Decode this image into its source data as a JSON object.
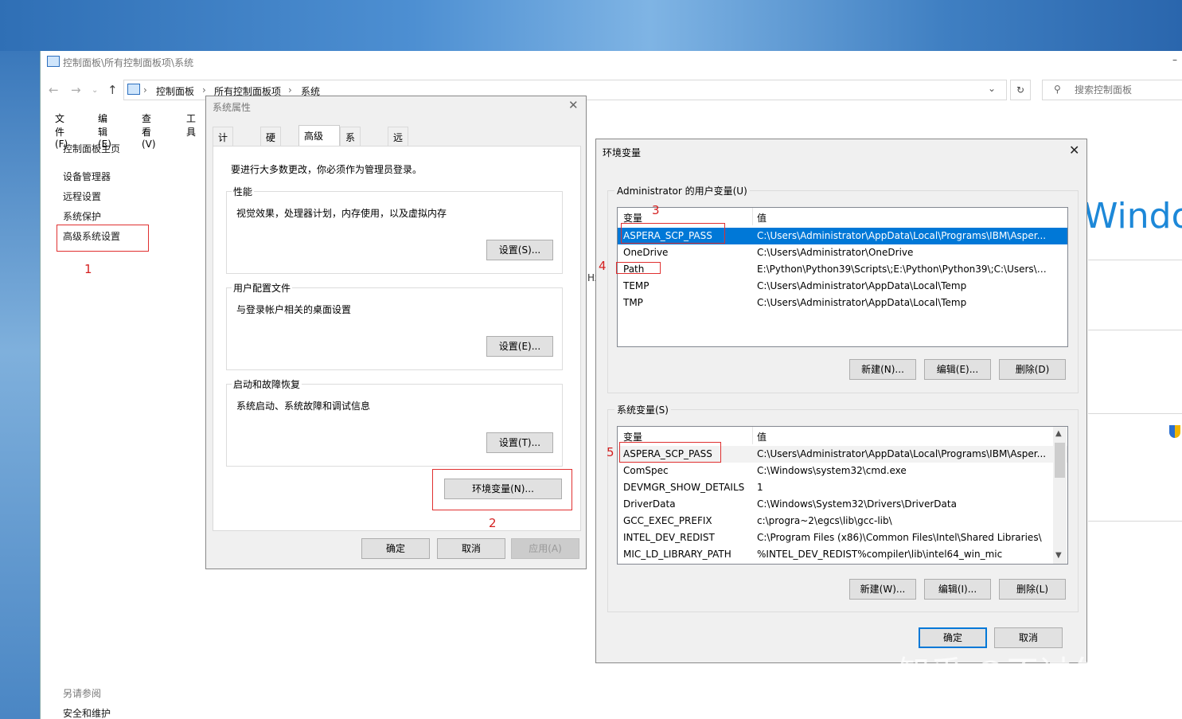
{
  "control_panel": {
    "title": "控制面板\\所有控制面板项\\系统",
    "breadcrumbs": [
      "控制面板",
      "所有控制面板项",
      "系统"
    ],
    "search_placeholder": "搜索控制面板",
    "menu": [
      "文件(F)",
      "编辑(E)",
      "查看(V)",
      "工具"
    ],
    "sidebar": {
      "home": "控制面板主页",
      "links": [
        "设备管理器",
        "远程设置",
        "系统保护",
        "高级系统设置"
      ],
      "see_also_title": "另请参阅",
      "see_also": [
        "安全和维护"
      ]
    },
    "windows_logo_text": "Windov",
    "hz_text": "Hz"
  },
  "annotations": {
    "n1": "1",
    "n2": "2",
    "n3": "3",
    "n4": "4",
    "n5": "5"
  },
  "system_properties": {
    "title": "系统属性",
    "tabs": [
      "计算机名",
      "硬件",
      "高级",
      "系统保护",
      "远程"
    ],
    "active_tab": "高级",
    "admin_note": "要进行大多数更改，你必须作为管理员登录。",
    "groups": [
      {
        "title": "性能",
        "desc": "视觉效果，处理器计划，内存使用，以及虚拟内存",
        "button": "设置(S)..."
      },
      {
        "title": "用户配置文件",
        "desc": "与登录帐户相关的桌面设置",
        "button": "设置(E)..."
      },
      {
        "title": "启动和故障恢复",
        "desc": "系统启动、系统故障和调试信息",
        "button": "设置(T)..."
      }
    ],
    "env_button": "环境变量(N)...",
    "ok": "确定",
    "cancel": "取消",
    "apply": "应用(A)"
  },
  "env_vars": {
    "title": "环境变量",
    "user_group_title": "Administrator 的用户变量(U)",
    "system_group_title": "系统变量(S)",
    "col_var": "变量",
    "col_val": "值",
    "user_vars": [
      {
        "var": "ASPERA_SCP_PASS",
        "val": "C:\\Users\\Administrator\\AppData\\Local\\Programs\\IBM\\Asper..."
      },
      {
        "var": "OneDrive",
        "val": "C:\\Users\\Administrator\\OneDrive"
      },
      {
        "var": "Path",
        "val": "E:\\Python\\Python39\\Scripts\\;E:\\Python\\Python39\\;C:\\Users\\Ad..."
      },
      {
        "var": "TEMP",
        "val": "C:\\Users\\Administrator\\AppData\\Local\\Temp"
      },
      {
        "var": "TMP",
        "val": "C:\\Users\\Administrator\\AppData\\Local\\Temp"
      }
    ],
    "system_vars": [
      {
        "var": "ASPERA_SCP_PASS",
        "val": "C:\\Users\\Administrator\\AppData\\Local\\Programs\\IBM\\Asper..."
      },
      {
        "var": "ComSpec",
        "val": "C:\\Windows\\system32\\cmd.exe"
      },
      {
        "var": "DEVMGR_SHOW_DETAILS",
        "val": "1"
      },
      {
        "var": "DriverData",
        "val": "C:\\Windows\\System32\\Drivers\\DriverData"
      },
      {
        "var": "GCC_EXEC_PREFIX",
        "val": "c:\\progra~2\\egcs\\lib\\gcc-lib\\"
      },
      {
        "var": "INTEL_DEV_REDIST",
        "val": "C:\\Program Files (x86)\\Common Files\\Intel\\Shared Libraries\\"
      },
      {
        "var": "MIC_LD_LIBRARY_PATH",
        "val": "%INTEL_DEV_REDIST%compiler\\lib\\intel64_win_mic"
      }
    ],
    "user_buttons": {
      "new": "新建(N)...",
      "edit": "编辑(E)...",
      "delete": "删除(D)"
    },
    "system_buttons": {
      "new": "新建(W)...",
      "edit": "编辑(I)...",
      "delete": "删除(L)"
    },
    "ok": "确定",
    "cancel": "取消"
  },
  "watermark": "知乎 @不过尔尔",
  "colors": {
    "selection": "#0078d7",
    "annotation_red": "#e03030",
    "windows_blue": "#1d88d8"
  }
}
